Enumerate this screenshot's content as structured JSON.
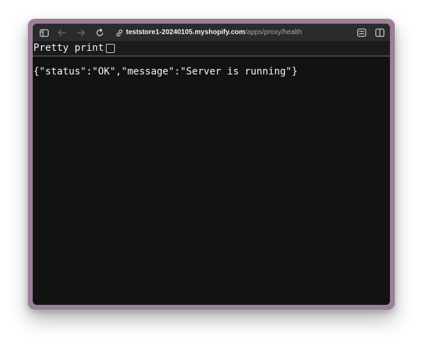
{
  "browser": {
    "url_host": "teststore1-20240105.myshopify.com",
    "url_path": "/apps/proxy/health",
    "icons": {
      "sidebar": "sidebar-icon",
      "back": "back-arrow-icon",
      "forward": "forward-arrow-icon",
      "reload": "reload-icon",
      "link": "link-icon",
      "reader": "reader-icon",
      "split": "split-view-icon"
    }
  },
  "viewer": {
    "pretty_print_label": "Pretty print",
    "pretty_print_checked": false,
    "json_text": "{\"status\":\"OK\",\"message\":\"Server is running\"}"
  },
  "colors": {
    "window_frame": "#9b7f9b",
    "toolbar": "#2b2b2d",
    "content_bg": "#121212",
    "text": "#f4f4f4"
  }
}
